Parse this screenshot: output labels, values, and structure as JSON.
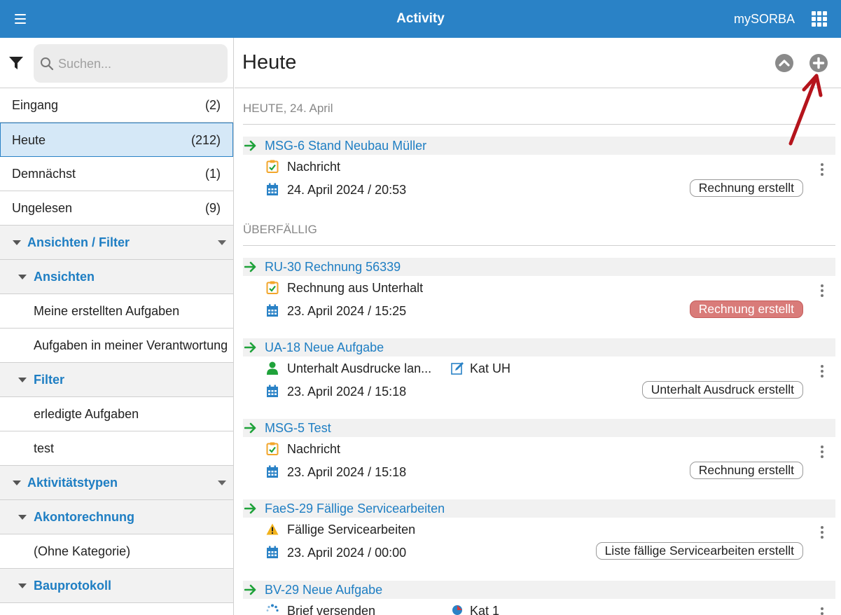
{
  "topbar": {
    "title": "Activity",
    "brand": "mySORBA",
    "menu_icon": "hamburger-icon",
    "apps_icon": "grid-apps-icon",
    "color": "#2a82c6"
  },
  "search": {
    "placeholder": "Suchen..."
  },
  "sidebar": {
    "inbox": [
      {
        "label": "Eingang",
        "count": "(2)",
        "active": false
      },
      {
        "label": "Heute",
        "count": "(212)",
        "active": true
      },
      {
        "label": "Demnächst",
        "count": "(1)",
        "active": false
      },
      {
        "label": "Ungelesen",
        "count": "(9)",
        "active": false
      }
    ],
    "views_filter": {
      "label": "Ansichten / Filter"
    },
    "views": {
      "label": "Ansichten",
      "items": [
        "Meine erstellten Aufgaben",
        "Aufgaben in meiner Verantwortung"
      ]
    },
    "filter": {
      "label": "Filter",
      "items": [
        "erledigte Aufgaben",
        "test"
      ]
    },
    "activity_types": {
      "label": "Aktivitätstypen"
    },
    "akonto": {
      "label": "Akontorechnung",
      "items": [
        "(Ohne Kategorie)"
      ]
    },
    "bauprotokoll": {
      "label": "Bauprotokoll"
    }
  },
  "main": {
    "title": "Heute",
    "sections": {
      "today": "HEUTE, 24. April",
      "overdue": "ÜBERFÄLLIG"
    },
    "items": [
      {
        "title": "MSG-6 Stand Neubau Müller",
        "type": "Nachricht",
        "type_icon": "clipboard-check-icon",
        "date": "24. April 2024 / 20:53",
        "pill": "Rechnung erstellt",
        "pill_red": false
      },
      {
        "title": "RU-30 Rechnung 56339",
        "type": "Rechnung aus Unterhalt",
        "type_icon": "clipboard-check-icon",
        "date": "23. April 2024 / 15:25",
        "pill": "Rechnung erstellt",
        "pill_red": true
      },
      {
        "title": "UA-18 Neue Aufgabe",
        "type": "Unterhalt Ausdrucke lan...",
        "type_icon": "person-icon",
        "category": "Kat UH",
        "category_icon": "edit-icon",
        "date": "23. April 2024 / 15:18",
        "pill": "Unterhalt Ausdruck erstellt",
        "pill_red": false
      },
      {
        "title": "MSG-5 Test",
        "type": "Nachricht",
        "type_icon": "clipboard-check-icon",
        "date": "23. April 2024 / 15:18",
        "pill": "Rechnung erstellt",
        "pill_red": false
      },
      {
        "title": "FaeS-29 Fällige Servicearbeiten",
        "type": "Fällige Servicearbeiten",
        "type_icon": "warning-icon",
        "date": "23. April 2024 / 00:00",
        "pill": "Liste fällige Servicearbeiten erstellt",
        "pill_red": false
      },
      {
        "title": "BV-29 Neue Aufgabe",
        "type": "Brief versenden",
        "type_icon": "spinner-icon",
        "category": "Kat 1",
        "category_icon": "tag-icon"
      }
    ]
  }
}
